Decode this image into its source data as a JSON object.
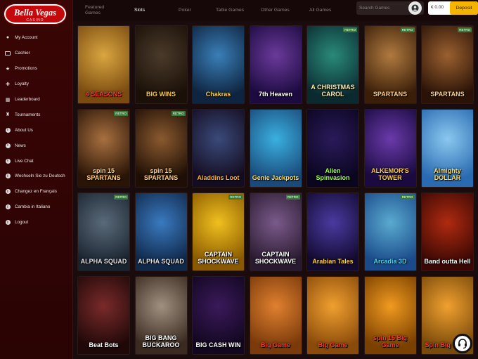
{
  "logo": {
    "brand": "Bella Vegas",
    "sub": "CASINO"
  },
  "sidebar": {
    "items": [
      {
        "label": "My Account",
        "icon": "user-icon"
      },
      {
        "label": "Cashier",
        "icon": "card-icon"
      },
      {
        "label": "Promotions",
        "icon": "star-icon"
      },
      {
        "label": "Loyalty",
        "icon": "gift-icon"
      },
      {
        "label": "Leaderboard",
        "icon": "chart-icon"
      },
      {
        "label": "Tournaments",
        "icon": "trophy-icon"
      },
      {
        "label": "About Us",
        "icon": "info-icon"
      },
      {
        "label": "News",
        "icon": "info-icon"
      },
      {
        "label": "Live Chat",
        "icon": "info-icon"
      },
      {
        "label": "Wechseln Sie zu Deutsch",
        "icon": "info-icon"
      },
      {
        "label": "Changez en Français",
        "icon": "info-icon"
      },
      {
        "label": "Cambia in Italiano",
        "icon": "info-icon"
      },
      {
        "label": "Logout",
        "icon": "info-icon"
      }
    ]
  },
  "topbar": {
    "tabs": [
      {
        "label": "Featured Games",
        "active": false
      },
      {
        "label": "Slots",
        "active": true
      },
      {
        "label": "Poker",
        "active": false
      },
      {
        "label": "Table Games",
        "active": false
      },
      {
        "label": "Other Games",
        "active": false
      },
      {
        "label": "All Games",
        "active": false
      }
    ],
    "search_placeholder": "Search Games",
    "balance": "€ 0.00",
    "deposit_label": "Deposit"
  },
  "games": [
    {
      "title": "4 SEASONS",
      "retro": false,
      "colors": [
        "#d9a640",
        "#7a4a10"
      ],
      "text": "#ff3a2a"
    },
    {
      "title": "BIG WINS",
      "retro": false,
      "colors": [
        "#4a3a2a",
        "#1a1008"
      ],
      "text": "#ffcc33"
    },
    {
      "title": "Chakras",
      "retro": false,
      "colors": [
        "#3a7fb8",
        "#0e2440"
      ],
      "text": "#ffd040"
    },
    {
      "title": "7th Heaven",
      "retro": false,
      "colors": [
        "#6a3a9a",
        "#1c0a40"
      ],
      "text": "#ffffff"
    },
    {
      "title": "A CHRISTMAS CAROL",
      "retro": true,
      "colors": [
        "#2a8a7a",
        "#0a2a30"
      ],
      "text": "#ffeeaa"
    },
    {
      "title": "SPARTANS",
      "retro": true,
      "colors": [
        "#b07a40",
        "#3a1e08"
      ],
      "text": "#ffd080"
    },
    {
      "title": "SPARTANS",
      "retro": true,
      "colors": [
        "#9a6030",
        "#2a1206"
      ],
      "text": "#ffd080"
    },
    {
      "title": "spin 15 SPARTANS",
      "retro": true,
      "colors": [
        "#a87040",
        "#2a1406"
      ],
      "text": "#ffd080"
    },
    {
      "title": "spin 15 SPARTANS",
      "retro": true,
      "colors": [
        "#8a5a30",
        "#1e0e04"
      ],
      "text": "#ffd080"
    },
    {
      "title": "Aladdins Loot",
      "retro": false,
      "colors": [
        "#3a4a7a",
        "#140c20"
      ],
      "text": "#ffb030"
    },
    {
      "title": "Genie Jackpots",
      "retro": false,
      "colors": [
        "#3ab0e0",
        "#1a4a7a"
      ],
      "text": "#ffe060"
    },
    {
      "title": "Alien Spinvasion",
      "retro": false,
      "colors": [
        "#2a1a5a",
        "#0a0620"
      ],
      "text": "#9aff40"
    },
    {
      "title": "ALKEMOR'S TOWER",
      "retro": false,
      "colors": [
        "#6a3aaa",
        "#1a0a40"
      ],
      "text": "#ffcc40"
    },
    {
      "title": "Almighty DOLLAR",
      "retro": false,
      "colors": [
        "#8ac8f0",
        "#2a6ab0"
      ],
      "text": "#ffe060"
    },
    {
      "title": "ALPHA SQUAD",
      "retro": true,
      "colors": [
        "#5a6a7a",
        "#1a2430"
      ],
      "text": "#e0e0e0"
    },
    {
      "title": "ALPHA SQUAD",
      "retro": false,
      "colors": [
        "#3a7ac0",
        "#10284a"
      ],
      "text": "#e0e0e0"
    },
    {
      "title": "CAPTAIN SHOCKWAVE",
      "retro": true,
      "colors": [
        "#f0c020",
        "#8a5a00"
      ],
      "text": "#ffffff"
    },
    {
      "title": "CAPTAIN SHOCKWAVE",
      "retro": true,
      "colors": [
        "#7a5a8a",
        "#2a1a30"
      ],
      "text": "#ffffff"
    },
    {
      "title": "Arabian Tales",
      "retro": false,
      "colors": [
        "#4a3aa0",
        "#120a30"
      ],
      "text": "#ffd040"
    },
    {
      "title": "Arcadia 3D",
      "retro": true,
      "colors": [
        "#5aaad0",
        "#1a4a8a"
      ],
      "text": "#40e0ff"
    },
    {
      "title": "Band outta Hell",
      "retro": false,
      "colors": [
        "#b02a10",
        "#3a0804"
      ],
      "text": "#ffffff"
    },
    {
      "title": "Beat Bots",
      "retro": false,
      "colors": [
        "#7a2a2a",
        "#200808"
      ],
      "text": "#ffffff"
    },
    {
      "title": "BIG BANG BUCKAROO",
      "retro": false,
      "colors": [
        "#a09080",
        "#3a2a20"
      ],
      "text": "#ffffff"
    },
    {
      "title": "BIG CASH WIN",
      "retro": false,
      "colors": [
        "#3a1a5a",
        "#120620"
      ],
      "text": "#ffffff"
    },
    {
      "title": "Big Game",
      "retro": false,
      "colors": [
        "#e08030",
        "#7a3a0a"
      ],
      "text": "#ff3a20"
    },
    {
      "title": "Big Game",
      "retro": false,
      "colors": [
        "#f0a030",
        "#8a4a0a"
      ],
      "text": "#ff3a20"
    },
    {
      "title": "spin 15 Big Game",
      "retro": false,
      "colors": [
        "#f09a20",
        "#7a4000"
      ],
      "text": "#ff3a20"
    },
    {
      "title": "Spin Big Game",
      "retro": false,
      "colors": [
        "#f0a030",
        "#7a4a0a"
      ],
      "text": "#ff3a20"
    }
  ]
}
